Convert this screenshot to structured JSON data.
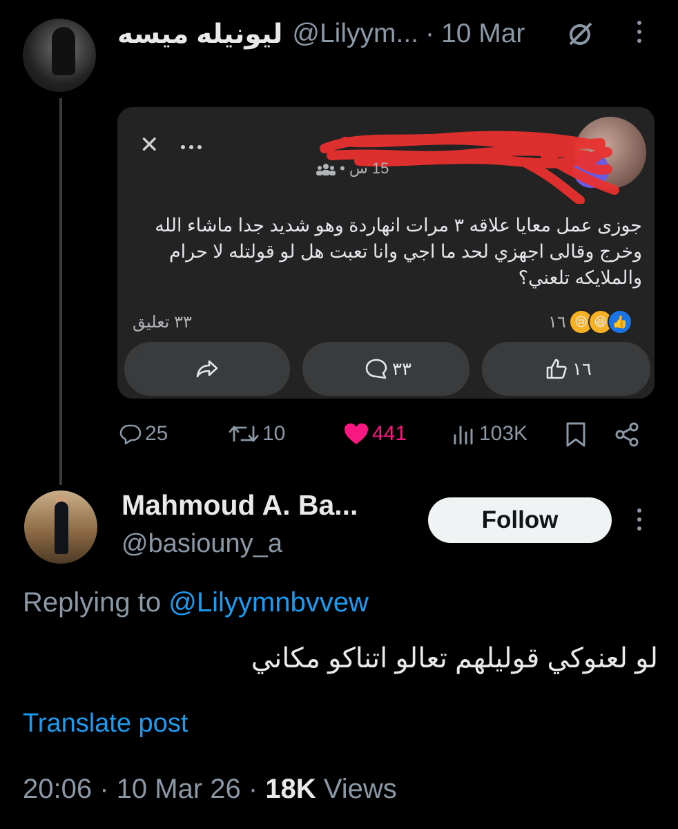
{
  "quoted_tweet": {
    "display_name": "ليونيله ميسه",
    "handle": "@Lilyym...",
    "separator": "·",
    "date": "10 Mar",
    "stats": {
      "replies": "25",
      "retweets": "10",
      "likes": "441",
      "views": "103K"
    },
    "like_color": "#f91880"
  },
  "embedded_facebook_post": {
    "meta": "15 س • ",
    "text": "جوزى عمل معايا علاقه ٣ مرات انهاردة وهو شديد جدا ماشاء الله وخرج وقالى اجهزي لحد ما اجي وانا تعبت هل لو قولتله لا حرام والملايكه تلعني؟",
    "comments_label": "٣٣ تعليق",
    "reactions_count": "١٦",
    "reaction_icons": [
      "sad-reaction",
      "haha-reaction",
      "like-reaction"
    ],
    "buttons": {
      "share_icon": "share-icon",
      "comment_count": "٣٣",
      "like_count": "١٦"
    },
    "redaction_color": "#e8322f"
  },
  "reply": {
    "display_name": "Mahmoud A. Ba...",
    "handle": "@basiouny_a",
    "follow_label": "Follow",
    "replying_prefix": "Replying to",
    "replying_to": "@Lilyymnbvvew",
    "text": "لو لعنوكي قوليلهم تعالو اتناكو مكاني",
    "translate_label": "Translate post",
    "timestamp": "20:06 · 10 Mar 26 ·",
    "views_count": "18K",
    "views_label": "Views"
  },
  "colors": {
    "link": "#1d9bf0",
    "muted": "#8b98a5",
    "background": "#000000"
  }
}
